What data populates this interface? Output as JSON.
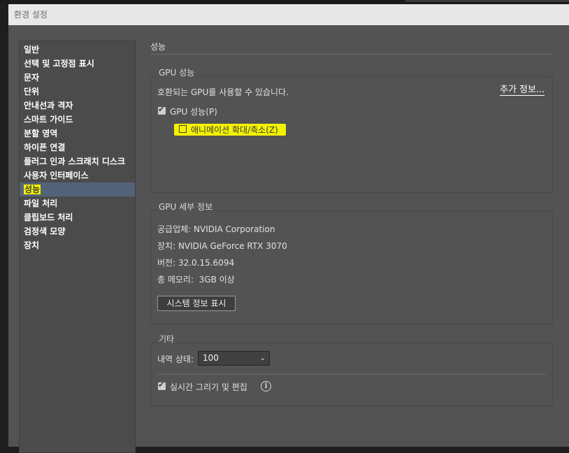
{
  "window": {
    "title": "환경 설정"
  },
  "sidebar": {
    "items": [
      {
        "label": "일반"
      },
      {
        "label": "선택 및 고정점 표시"
      },
      {
        "label": "문자"
      },
      {
        "label": "단위"
      },
      {
        "label": "안내선과 격자"
      },
      {
        "label": "스마트 가이드"
      },
      {
        "label": "분할 영역"
      },
      {
        "label": "하이픈 연결"
      },
      {
        "label": "플러그 인과 스크래치 디스크"
      },
      {
        "label": "사용자 인터페이스"
      },
      {
        "label": "성능",
        "selected": true
      },
      {
        "label": "파일 처리"
      },
      {
        "label": "클립보드 처리"
      },
      {
        "label": "검정색 모양"
      },
      {
        "label": "장치"
      }
    ]
  },
  "main": {
    "section_title": "성능",
    "gpu_performance": {
      "legend": "GPU 성능",
      "compat_text": "호환되는 GPU를 사용할 수 있습니다.",
      "more_info": "추가 정보...",
      "gpu_checkbox_label": "GPU 성능(P)",
      "gpu_checked": true,
      "animated_zoom_label": "애니메이션 확대/축소(Z)",
      "animated_zoom_checked": false
    },
    "gpu_details": {
      "legend": "GPU 세부 정보",
      "vendor": "공급업체: NVIDIA Corporation",
      "device": "장치: NVIDIA GeForce RTX 3070",
      "version": "버전: 32.0.15.6094",
      "memory": "총 메모리:  3GB 이상",
      "system_info_button": "시스템 정보 표시"
    },
    "other": {
      "legend": "기타",
      "history_label": "내역 상태:",
      "history_value": "100",
      "live_drawing_label": "실시간 그리기 및 편집",
      "live_drawing_checked": true
    }
  },
  "colors": {
    "dialog_bg": "#535353",
    "sidebar_bg": "#4b4b4b",
    "selected_bg": "#546377",
    "highlight": "#f4f200"
  }
}
